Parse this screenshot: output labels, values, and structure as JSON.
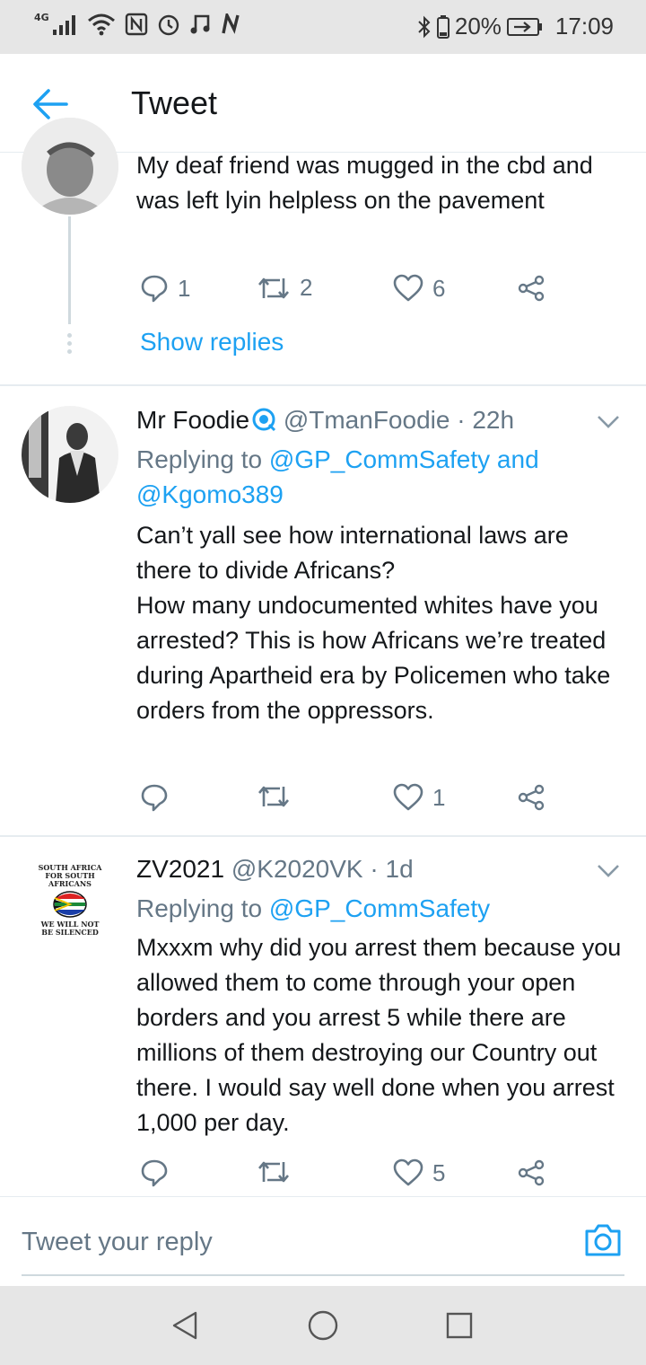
{
  "status_bar": {
    "network": "4G",
    "time": "17:09",
    "battery": "20%",
    "left_icons": [
      "signal-icon",
      "wifi-icon",
      "nfc-icon",
      "alarm-icon",
      "music-icon",
      "n-notification-icon"
    ],
    "right_icons": [
      "bluetooth-icon",
      "battery-low-icon",
      "charging-icon"
    ]
  },
  "app_bar": {
    "title": "Tweet"
  },
  "tweets": [
    {
      "text": "My deaf friend was mugged in the cbd and was left lyin helpless on the pavement",
      "actions": {
        "replies": "1",
        "retweets": "2",
        "likes": "6"
      },
      "show_replies": "Show replies"
    },
    {
      "name": "Mr Foodie",
      "verified_icon": "verified-badge-icon",
      "handle": "@TmanFoodie",
      "time": "· 22h",
      "replying_label": "Replying to",
      "mention_1": "@GP_CommSafety and",
      "mention_2": "@Kgomo389",
      "text": "Can’t yall see how international laws are there to divide Africans?\nHow many undocumented whites have you arrested? This is how Africans we’re treated during Apartheid era by Policemen who take orders from the oppressors.",
      "actions": {
        "replies": "",
        "retweets": "",
        "likes": "1"
      }
    },
    {
      "name": "ZV2021",
      "handle": "@K2020VK",
      "time": "· 1d",
      "replying_label": "Replying to",
      "mention_1": "@GP_CommSafety",
      "avatar_text_top": "SOUTH AFRICA FOR SOUTH AFRICANS",
      "avatar_text_bottom": "WE WILL NOT BE SILENCED",
      "text": "Mxxxm why did you arrest them because you allowed them to come through your open borders and you arrest 5 while there are millions of them destroying our Country out there. I would say well done when you arrest 1,000 per day.",
      "actions": {
        "replies": "",
        "retweets": "",
        "likes": "5"
      }
    }
  ],
  "reply_box": {
    "placeholder": "Tweet your reply"
  },
  "colors": {
    "accent": "#1da1f2",
    "secondary_text": "#657786",
    "primary_text": "#14171a",
    "divider": "#e6ecf0"
  }
}
